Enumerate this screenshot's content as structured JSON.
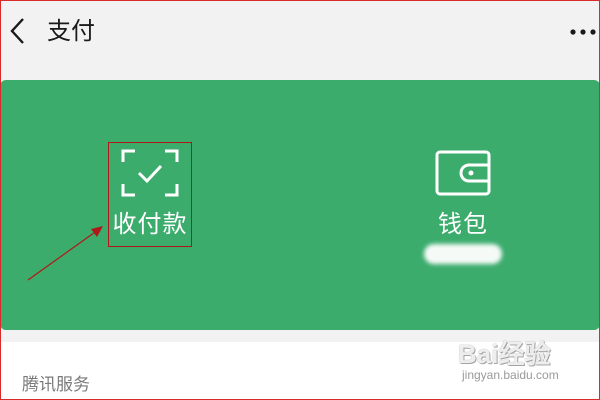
{
  "header": {
    "back_icon": "chevron-left-icon",
    "title": "支付",
    "more_icon": "more-dots-icon"
  },
  "panel": {
    "background_color": "#3cac6d",
    "receive_pay": {
      "label": "收付款",
      "icon": "scan-check-icon"
    },
    "wallet": {
      "label": "钱包",
      "icon": "wallet-icon"
    }
  },
  "annotation": {
    "highlight_color": "#b01818"
  },
  "section": {
    "title": "腾讯服务"
  },
  "watermark": {
    "brand": "Bai经验",
    "url": "jingyan.baidu.com"
  }
}
